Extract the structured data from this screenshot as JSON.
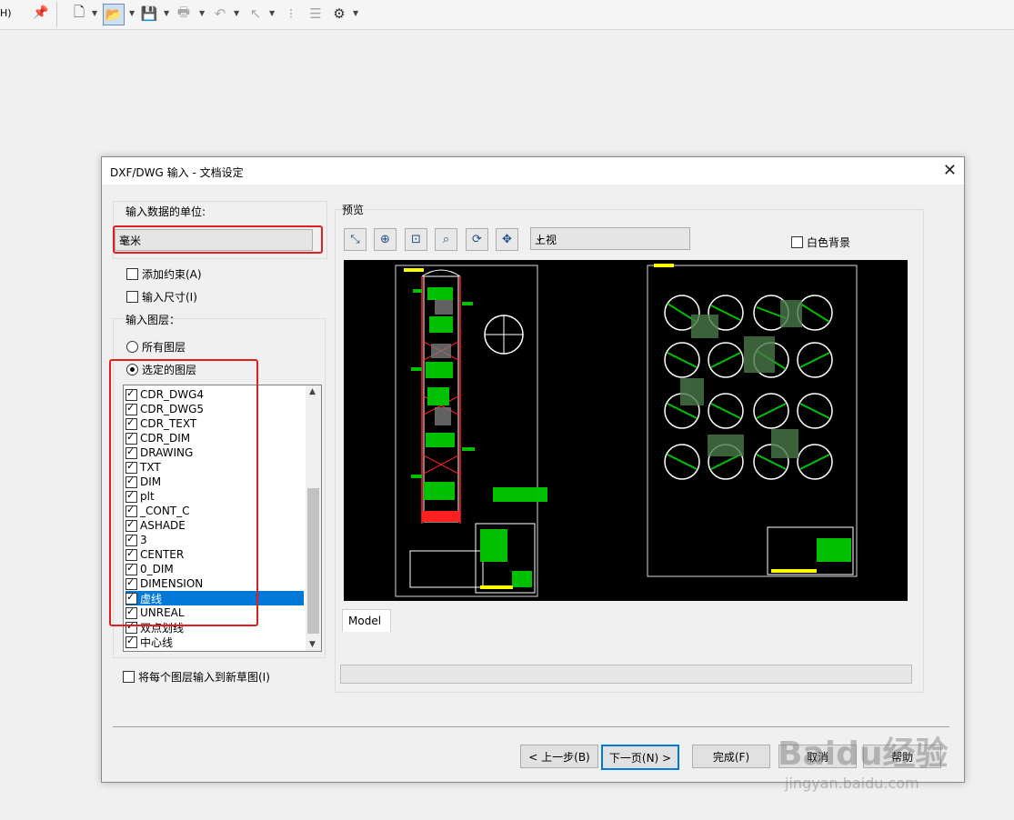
{
  "toolbar": {
    "left_label": "H)",
    "icons": [
      "pin-icon",
      "new-document-icon",
      "open-icon",
      "save-icon",
      "print-icon",
      "undo-icon",
      "select-icon",
      "traffic-light-icon",
      "properties-icon",
      "settings-icon"
    ]
  },
  "dialog": {
    "title": "DXF/DWG 输入 - 文档设定",
    "units_label": "输入数据的单位:",
    "units_value": "毫米",
    "add_constraints": "添加约束(A)",
    "import_dimensions": "输入尺寸(I)",
    "layers_label": "输入图层：",
    "all_layers": "所有图层",
    "selected_layers": "选定的图层",
    "layers": [
      "CDR_DWG4",
      "CDR_DWG5",
      "CDR_TEXT",
      "CDR_DIM",
      "DRAWING",
      "TXT",
      "DIM",
      "plt",
      "_CONT_C",
      "ASHADE",
      "3",
      "CENTER",
      "0_DIM",
      "DIMENSION",
      "虚线",
      "UNREAL",
      "双点划线",
      "中心线"
    ],
    "selected_layer_index": 14,
    "each_layer_new_sketch": "将每个图层输入到新草图(I)",
    "preview_label": "预览",
    "view_value": "上视",
    "white_background": "白色背景",
    "model_tab": "Model",
    "buttons": {
      "back": "< 上一步(B)",
      "next": "下一页(N) >",
      "finish": "完成(F)",
      "cancel": "取消",
      "help": "帮助"
    }
  },
  "watermark": {
    "big": "Baidu经验",
    "small": "jingyan.baidu.com"
  },
  "colors": {
    "highlight_red": "#e02020",
    "selection_blue": "#0078d7",
    "cad_green": "#00c000",
    "cad_yellow": "#ffff00",
    "cad_red": "#ff2020"
  }
}
